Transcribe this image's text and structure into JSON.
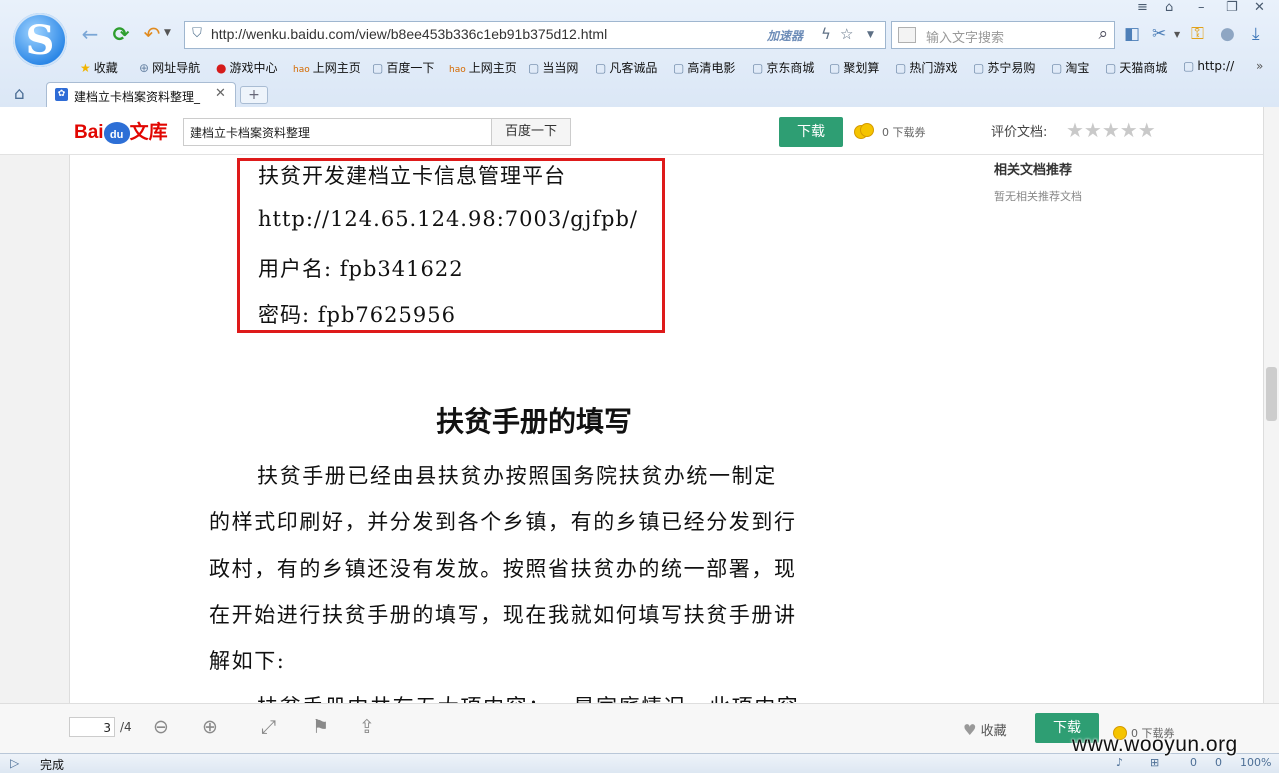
{
  "browser": {
    "url": "http://wenku.baidu.com/view/b8ee453b336c1eb91b375d12.html",
    "accelerator_label": "加速器",
    "search_placeholder": "输入文字搜索",
    "tab_title": "建档立卡档案资料整理_",
    "new_tab": "+",
    "window_controls": [
      "≡",
      "⌂",
      "–",
      "❐",
      "✕"
    ]
  },
  "favorites": [
    {
      "label": "收藏",
      "icon": "star-icon"
    },
    {
      "label": "网址导航",
      "icon": "globe-icon"
    },
    {
      "label": "游戏中心",
      "icon": "game-icon"
    },
    {
      "label": "上网主页",
      "icon": "hao-icon"
    },
    {
      "label": "百度一下",
      "icon": "page-icon"
    },
    {
      "label": "上网主页",
      "icon": "hao-icon"
    },
    {
      "label": "当当网",
      "icon": "page-icon"
    },
    {
      "label": "凡客诚品",
      "icon": "page-icon"
    },
    {
      "label": "高清电影",
      "icon": "page-icon"
    },
    {
      "label": "京东商城",
      "icon": "page-icon"
    },
    {
      "label": "聚划算",
      "icon": "page-icon"
    },
    {
      "label": "热门游戏",
      "icon": "page-icon"
    },
    {
      "label": "苏宁易购",
      "icon": "page-icon"
    },
    {
      "label": "淘宝",
      "icon": "page-icon"
    },
    {
      "label": "天猫商城",
      "icon": "page-icon"
    },
    {
      "label": "http://",
      "icon": "page-icon"
    }
  ],
  "wenku": {
    "logo_bai": "Bai",
    "logo_du": "du",
    "logo_wenku": "文库",
    "search_value": "建档立卡档案资料整理",
    "search_button": "百度一下",
    "download_button": "下载",
    "coupon_text": "0 下载券",
    "rate_label": "评价文档:",
    "rating_stars": "★★★★★",
    "rating_value": 0,
    "related_title": "相关文档推荐",
    "related_empty": "暂无相关推荐文档"
  },
  "document": {
    "cred_platform": "扶贫开发建档立卡信息管理平台",
    "cred_url": "http://124.65.124.98:7003/gjfpb/",
    "cred_user": "用户名: fpb341622",
    "cred_pass": "密码: fpb7625956",
    "section_title": "扶贫手册的填写",
    "para_lines": [
      "扶贫手册已经由县扶贫办按照国务院扶贫办统一制定",
      "的样式印刷好，并分发到各个乡镇，有的乡镇已经分发到行",
      "政村，有的乡镇还没有发放。按照省扶贫办的统一部署，现",
      "在开始进行扶贫手册的填写，现在我就如何填写扶贫手册讲",
      "解如下:",
      "扶贫手册中共有五大项内容：一是家庭情况，此项内容"
    ]
  },
  "toolbar": {
    "page_current": "3",
    "page_total": "/4",
    "favorite_label": "收藏",
    "download_label": "下载",
    "coupon_text": "0 下载券"
  },
  "status": {
    "text": "完成",
    "counter1": "0",
    "counter2": "0",
    "zoom": "100%"
  },
  "watermark": "www.wooyun.org",
  "colors": {
    "accent_green": "#2e9e73",
    "highlight_red": "#de1a1a",
    "baidu_red": "#e10601",
    "baidu_blue": "#2d6fd6"
  }
}
